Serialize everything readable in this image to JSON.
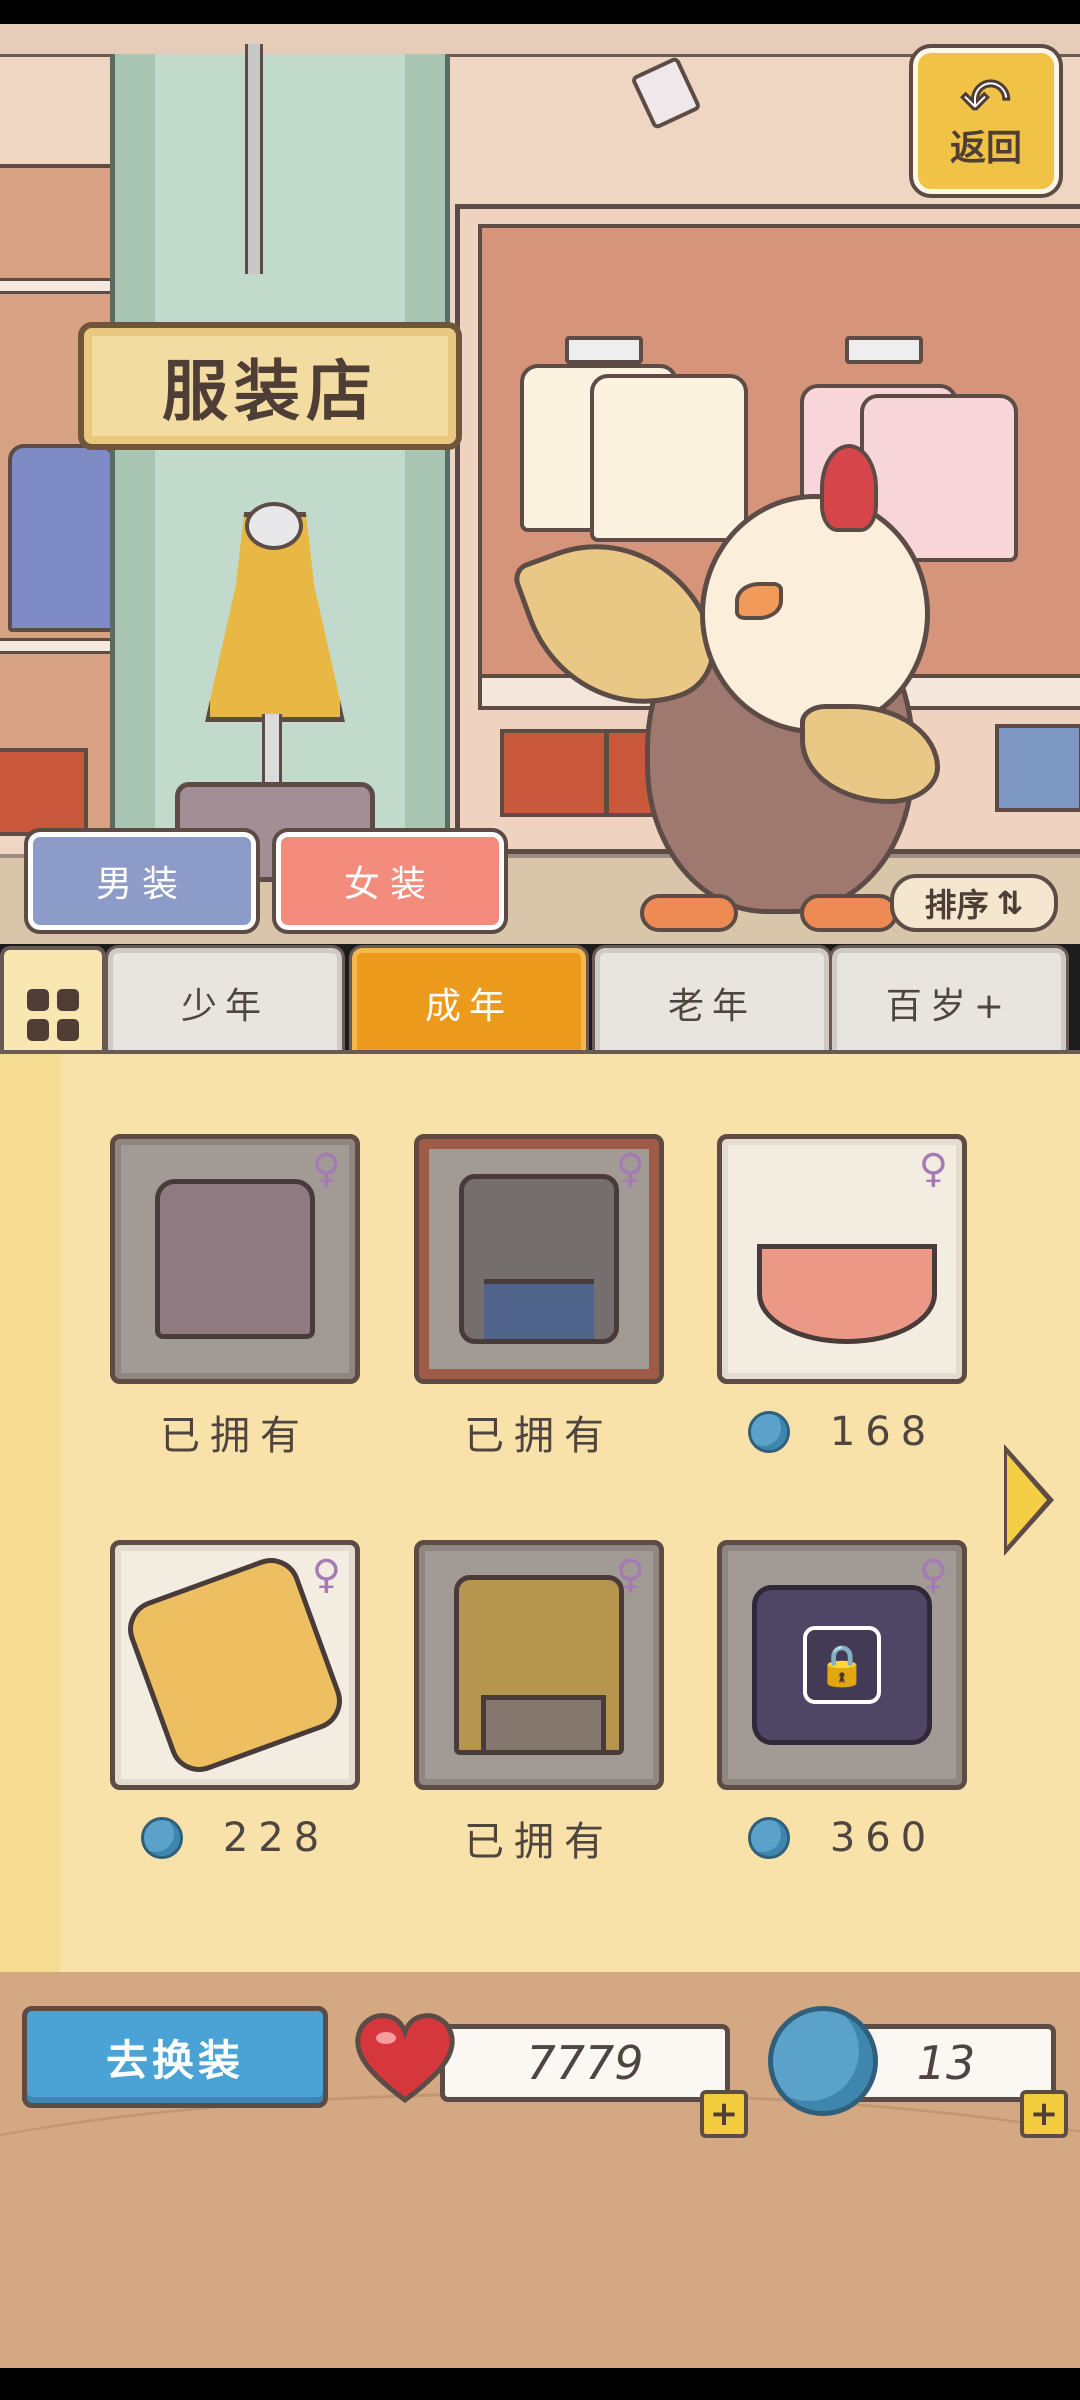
{
  "header": {
    "shop_sign": "服装店",
    "back_label": "返回",
    "back_arrow": "↶"
  },
  "gender_buttons": {
    "male": "男装",
    "female": "女装"
  },
  "sort": {
    "label": "排序",
    "icon": "⇅"
  },
  "tabs": [
    {
      "label": "少年",
      "active": false
    },
    {
      "label": "成年",
      "active": true
    },
    {
      "label": "老年",
      "active": false
    },
    {
      "label": "百岁+",
      "active": false
    }
  ],
  "items": [
    {
      "caption": "已拥有",
      "price": null,
      "owned": true,
      "gender": "♀",
      "color": "#8f7a82"
    },
    {
      "caption": "已拥有",
      "price": null,
      "owned": true,
      "gender": "♀",
      "color": "#756e6e"
    },
    {
      "caption": "168",
      "price": "168",
      "owned": false,
      "gender": "♀",
      "color": "#ec9886"
    },
    {
      "caption": "228",
      "price": "228",
      "owned": false,
      "gender": "♀",
      "color": "#eebf60"
    },
    {
      "caption": "已拥有",
      "price": null,
      "owned": true,
      "gender": "♀",
      "color": "#b6954e"
    },
    {
      "caption": "360",
      "price": "360",
      "owned": false,
      "locked": true,
      "gender": "♀",
      "color": "#4f4666"
    }
  ],
  "footer": {
    "change_outfit": "去换装",
    "hearts": "7779",
    "caps": "13",
    "plus": "+"
  }
}
